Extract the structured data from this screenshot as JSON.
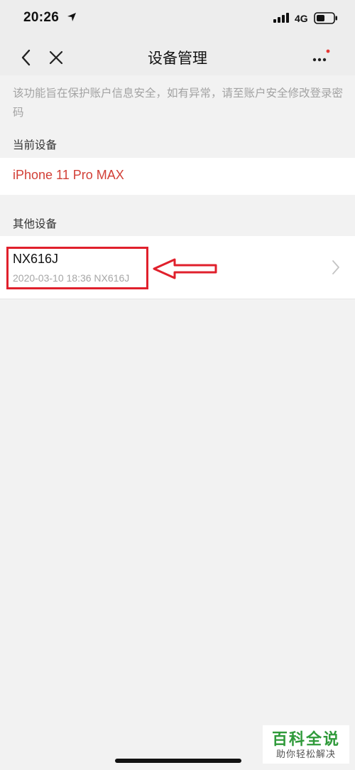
{
  "status_bar": {
    "time": "20:26",
    "network": "4G",
    "icons": [
      "location-arrow-icon",
      "signal-icon",
      "battery-icon"
    ]
  },
  "nav": {
    "title": "设备管理",
    "back_icon": "chevron-left-icon",
    "close_icon": "close-icon",
    "more_icon": "more-dots-icon",
    "badge_color": "#e53935"
  },
  "notice": "该功能旨在保护账户信息安全，如有异常，请至账户安全修改登录密码",
  "current_section": {
    "label": "当前设备",
    "device": "iPhone 11 Pro MAX",
    "device_color": "#d23f36"
  },
  "other_section": {
    "label": "其他设备",
    "devices": [
      {
        "name": "NX616J",
        "detail": "2020-03-10 18:36 NX616J"
      }
    ]
  },
  "annotation": {
    "color": "#e0202c"
  },
  "watermark": {
    "title": "百科全说",
    "subtitle": "助你轻松解决",
    "color": "#2f9a3a"
  }
}
